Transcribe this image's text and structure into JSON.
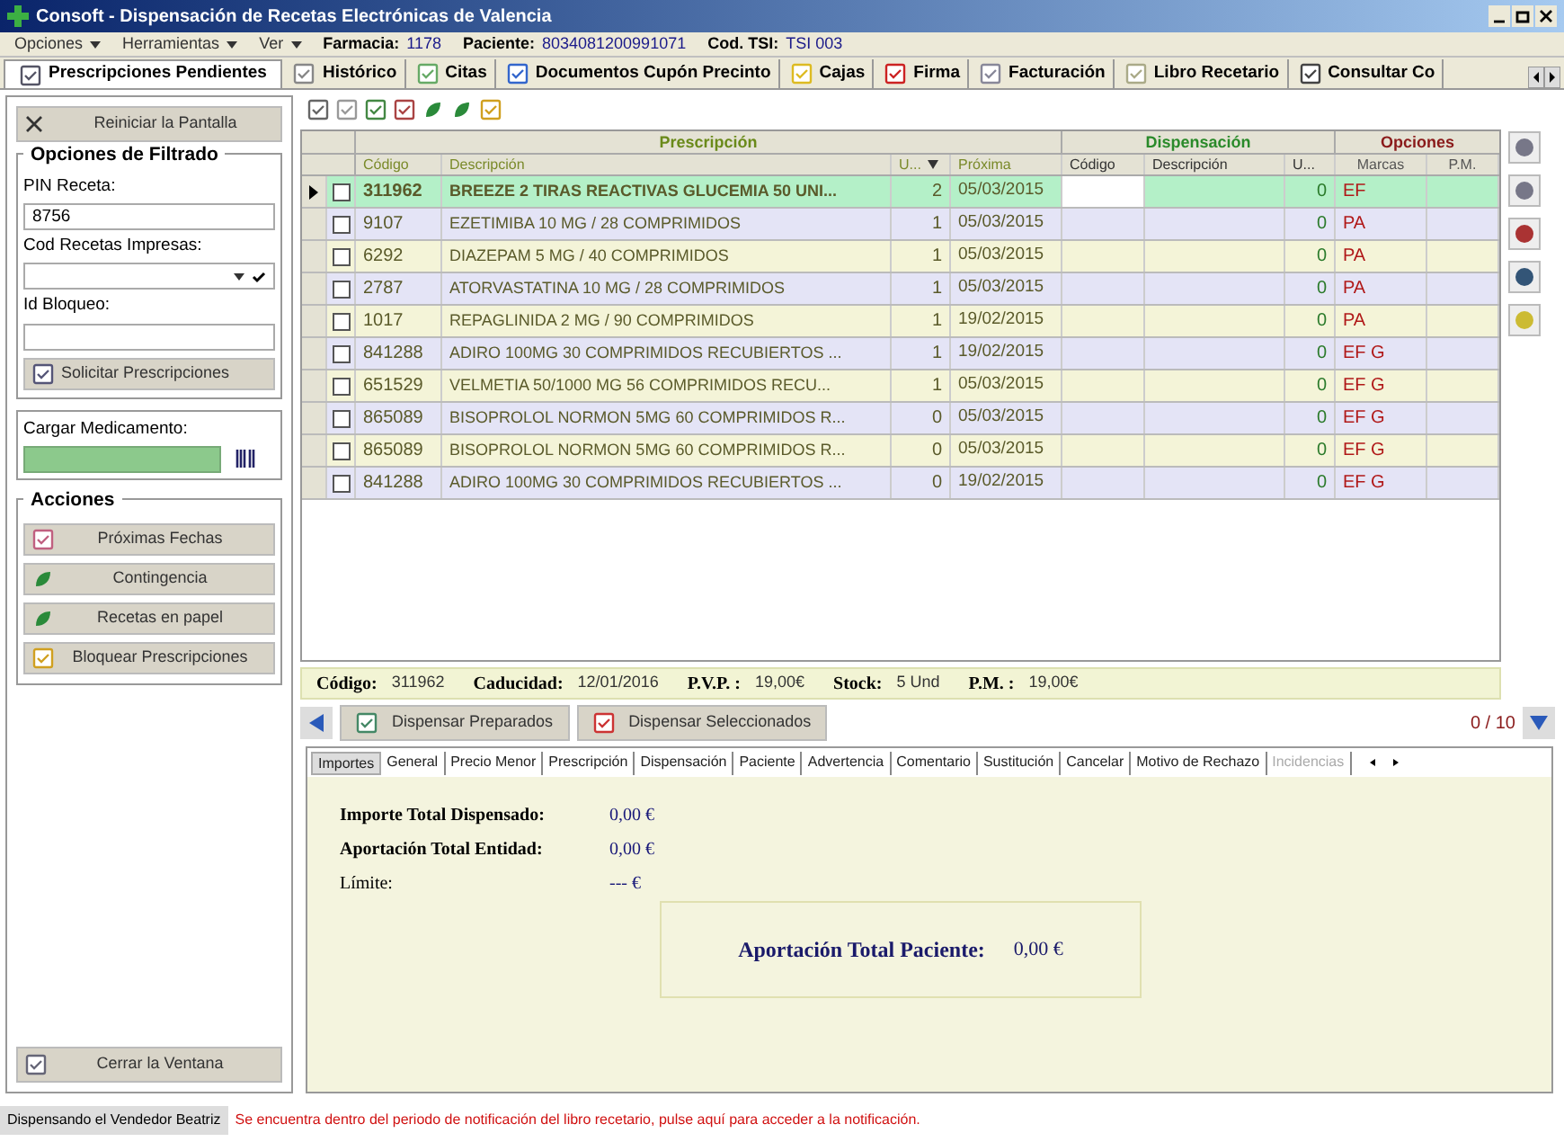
{
  "window": {
    "title": "Consoft - Dispensación de Recetas Electrónicas de Valencia"
  },
  "menu": [
    {
      "label": "Opciones"
    },
    {
      "label": "Herramientas"
    },
    {
      "label": "Ver"
    }
  ],
  "info": [
    {
      "label": "Farmacia:",
      "value": "1178"
    },
    {
      "label": "Paciente:",
      "value": "8034081200991071"
    },
    {
      "label": "Cod. TSI:",
      "value": "TSI 003"
    }
  ],
  "tabs": [
    {
      "label": "Prescripciones Pendientes",
      "selected": true
    },
    {
      "label": "Histórico",
      "selected": false
    },
    {
      "label": "Citas",
      "selected": false
    },
    {
      "label": "Documentos Cupón Precinto",
      "selected": false
    },
    {
      "label": "Cajas",
      "selected": false
    },
    {
      "label": "Firma",
      "selected": false
    },
    {
      "label": "Facturación",
      "selected": false
    },
    {
      "label": "Libro Recetario",
      "selected": false
    },
    {
      "label": "Consultar Co",
      "selected": false
    }
  ],
  "sidebar": {
    "reset_button": "Reiniciar la Pantalla",
    "filter": {
      "title": "Opciones de Filtrado",
      "pin_label": "PIN Receta:",
      "pin_value": "8756",
      "printed_label": "Cod Recetas Impresas:",
      "block_label": "Id Bloqueo:",
      "request_button": "Solicitar Prescripciones"
    },
    "load": {
      "label": "Cargar Medicamento:"
    },
    "actions": {
      "title": "Acciones",
      "buttons": [
        "Próximas Fechas",
        "Contingencia",
        "Recetas en papel",
        "Bloquear Prescripciones"
      ]
    },
    "close_button": "Cerrar la Ventana"
  },
  "table": {
    "groups": [
      "Prescripción",
      "Dispensación",
      "Opciones"
    ],
    "columns": [
      "Código",
      "Descripción",
      "U...",
      "Próxima",
      "Código",
      "Descripción",
      "U...",
      "Marcas",
      "P.M."
    ],
    "rows": [
      {
        "code": "311962",
        "description": "BREEZE 2 TIRAS REACTIVAS GLUCEMIA 50 UNI...",
        "units": "2",
        "next": "05/03/2015",
        "disp_units": "0",
        "marks": "EF",
        "selected": true,
        "checked": false
      },
      {
        "code": "9107",
        "description": "EZETIMIBA 10 MG / 28 COMPRIMIDOS",
        "units": "1",
        "next": "05/03/2015",
        "disp_units": "0",
        "marks": "PA",
        "selected": false,
        "checked": false
      },
      {
        "code": "6292",
        "description": "DIAZEPAM 5 MG / 40 COMPRIMIDOS",
        "units": "1",
        "next": "05/03/2015",
        "disp_units": "0",
        "marks": "PA",
        "selected": false,
        "checked": false
      },
      {
        "code": "2787",
        "description": "ATORVASTATINA 10 MG / 28 COMPRIMIDOS",
        "units": "1",
        "next": "05/03/2015",
        "disp_units": "0",
        "marks": "PA",
        "selected": false,
        "checked": false
      },
      {
        "code": "1017",
        "description": "REPAGLINIDA 2 MG / 90 COMPRIMIDOS",
        "units": "1",
        "next": "19/02/2015",
        "disp_units": "0",
        "marks": "PA",
        "selected": false,
        "checked": false
      },
      {
        "code": "841288",
        "description": "ADIRO 100MG 30 COMPRIMIDOS RECUBIERTOS ...",
        "units": "1",
        "next": "19/02/2015",
        "disp_units": "0",
        "marks": "EF G",
        "selected": false,
        "checked": false
      },
      {
        "code": "651529",
        "description": "VELMETIA 50/1000 MG 56 COMPRIMIDOS RECU...",
        "units": "1",
        "next": "05/03/2015",
        "disp_units": "0",
        "marks": "EF G",
        "selected": false,
        "checked": false
      },
      {
        "code": "865089",
        "description": "BISOPROLOL NORMON 5MG 60 COMPRIMIDOS R...",
        "units": "0",
        "next": "05/03/2015",
        "disp_units": "0",
        "marks": "EF G",
        "selected": false,
        "checked": false
      },
      {
        "code": "865089",
        "description": "BISOPROLOL NORMON 5MG 60 COMPRIMIDOS R...",
        "units": "0",
        "next": "05/03/2015",
        "disp_units": "0",
        "marks": "EF G",
        "selected": false,
        "checked": false
      },
      {
        "code": "841288",
        "description": "ADIRO 100MG 30 COMPRIMIDOS RECUBIERTOS ...",
        "units": "0",
        "next": "19/02/2015",
        "disp_units": "0",
        "marks": "EF G",
        "selected": false,
        "checked": false
      }
    ]
  },
  "detail": [
    {
      "label": "Código:",
      "value": "311962"
    },
    {
      "label": "Caducidad:",
      "value": "12/01/2016"
    },
    {
      "label": "P.V.P. :",
      "value": "19,00€"
    },
    {
      "label": "Stock:",
      "value": "5 Und"
    },
    {
      "label": "P.M. :",
      "value": "19,00€"
    }
  ],
  "dispense_buttons": [
    "Dispensar Preparados",
    "Dispensar Seleccionados"
  ],
  "counter": "0 / 10",
  "bottom_tabs": [
    {
      "label": "Importes",
      "selected": true,
      "disabled": false
    },
    {
      "label": "General",
      "selected": false,
      "disabled": false
    },
    {
      "label": "Precio Menor",
      "selected": false,
      "disabled": false
    },
    {
      "label": "Prescripción",
      "selected": false,
      "disabled": false
    },
    {
      "label": "Dispensación",
      "selected": false,
      "disabled": false
    },
    {
      "label": "Paciente",
      "selected": false,
      "disabled": false
    },
    {
      "label": "Advertencia",
      "selected": false,
      "disabled": false
    },
    {
      "label": "Comentario",
      "selected": false,
      "disabled": false
    },
    {
      "label": "Sustitución",
      "selected": false,
      "disabled": false
    },
    {
      "label": "Cancelar",
      "selected": false,
      "disabled": false
    },
    {
      "label": "Motivo de Rechazo",
      "selected": false,
      "disabled": false
    },
    {
      "label": "Incidencias",
      "selected": false,
      "disabled": true
    }
  ],
  "amounts": [
    {
      "label": "Importe Total Dispensado:",
      "value": "0,00 €"
    },
    {
      "label": "Aportación Total Entidad:",
      "value": "0,00 €"
    },
    {
      "label": "Límite:",
      "value": "--- €"
    }
  ],
  "patient_total": {
    "label": "Aportación Total Paciente:",
    "value": "0,00 €"
  },
  "status_bar": {
    "user": "Dispensando el Vendedor Beatriz",
    "notice": "Se encuentra dentro del periodo de notificación del libro recetario, pulse aquí para acceder a la notificación."
  }
}
